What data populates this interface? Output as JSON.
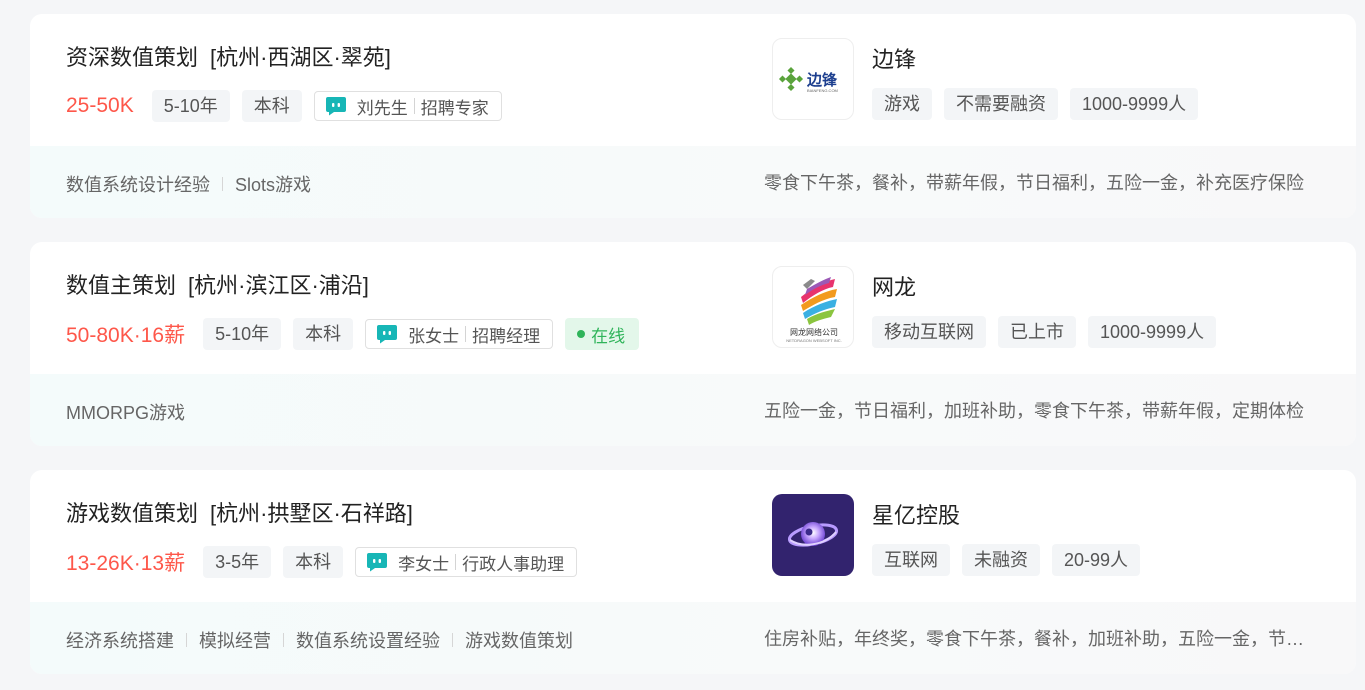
{
  "jobs": [
    {
      "title": "资深数值策划",
      "location": "[杭州·西湖区·翠苑]",
      "salary": "25-50K",
      "experience": "5-10年",
      "education": "本科",
      "recruiter_name": "刘先生",
      "recruiter_role": "招聘专家",
      "online": "",
      "company": "边锋",
      "logo": "bianfeng-logo",
      "logo_text": "边锋",
      "logo_subtext": "BIANFENG.COM",
      "company_tags": [
        "游戏",
        "不需要融资",
        "1000-9999人"
      ],
      "skills": [
        "数值系统设计经验",
        "Slots游戏"
      ],
      "benefits": "零食下午茶，餐补，带薪年假，节日福利，五险一金，补充医疗保险"
    },
    {
      "title": "数值主策划",
      "location": "[杭州·滨江区·浦沿]",
      "salary": "50-80K·16薪",
      "experience": "5-10年",
      "education": "本科",
      "recruiter_name": "张女士",
      "recruiter_role": "招聘经理",
      "online": "在线",
      "company": "网龙",
      "logo": "netdragon-logo",
      "logo_text": "网龙网络公司",
      "logo_subtext": "NETDRAGON WEBSOFT INC.",
      "company_tags": [
        "移动互联网",
        "已上市",
        "1000-9999人"
      ],
      "skills": [
        "MMORPG游戏"
      ],
      "benefits": "五险一金，节日福利，加班补助，零食下午茶，带薪年假，定期体检"
    },
    {
      "title": "游戏数值策划",
      "location": "[杭州·拱墅区·石祥路]",
      "salary": "13-26K·13薪",
      "experience": "3-5年",
      "education": "本科",
      "recruiter_name": "李女士",
      "recruiter_role": "行政人事助理",
      "online": "",
      "company": "星亿控股",
      "logo": "xingyi-logo",
      "logo_text": "",
      "logo_subtext": "",
      "company_tags": [
        "互联网",
        "未融资",
        "20-99人"
      ],
      "skills": [
        "经济系统搭建",
        "模拟经营",
        "数值系统设置经验",
        "游戏数值策划"
      ],
      "benefits": "住房补贴，年终奖，零食下午茶，餐补，加班补助，五险一金，节日福利"
    }
  ],
  "colors": {
    "salary": "#fe574a",
    "online": "#2fb45a",
    "chat_icon": "#17b6b6",
    "page_bg": "#f5f6f8"
  }
}
